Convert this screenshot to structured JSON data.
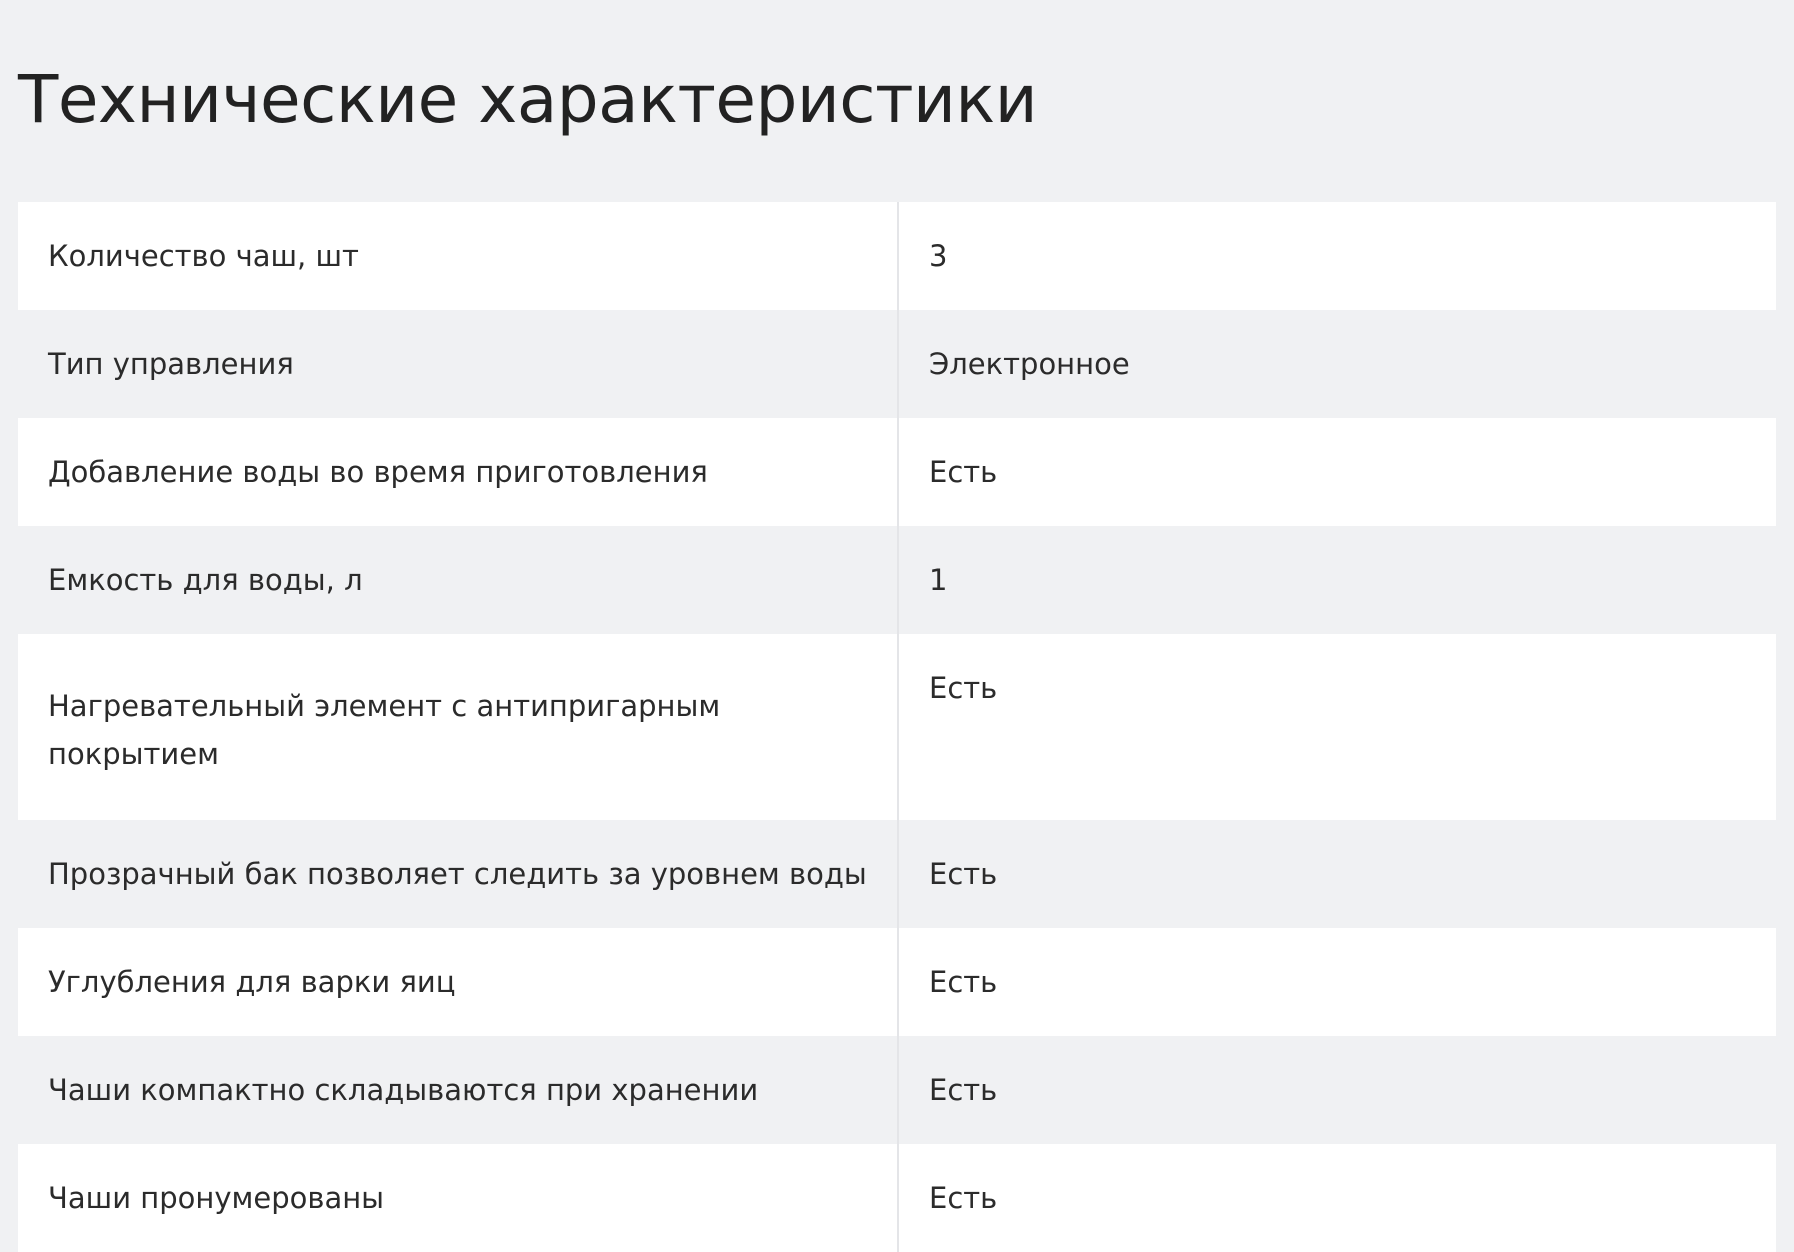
{
  "header": {
    "title": "Технические характеристики"
  },
  "specs": {
    "rows": [
      {
        "label": "Количество чаш, шт",
        "value": "3"
      },
      {
        "label": "Тип управления",
        "value": "Электронное"
      },
      {
        "label": "Добавление воды во время приготовления",
        "value": "Есть"
      },
      {
        "label": "Емкость для воды, л",
        "value": "1"
      },
      {
        "label": "Нагревательный элемент с антипригарным покрытием",
        "value": "Есть"
      },
      {
        "label": "Прозрачный бак позволяет следить за уровнем воды",
        "value": "Есть"
      },
      {
        "label": "Углубления для варки яиц",
        "value": "Есть"
      },
      {
        "label": "Чаши компактно складываются при хранении",
        "value": "Есть"
      },
      {
        "label": "Чаши пронумерованы",
        "value": "Есть"
      }
    ]
  },
  "colors": {
    "page_background": "#f0f1f3",
    "row_light": "#ffffff",
    "row_dark": "#f0f1f3",
    "text": "#2b2b2b",
    "divider": "#e4e5e8"
  }
}
